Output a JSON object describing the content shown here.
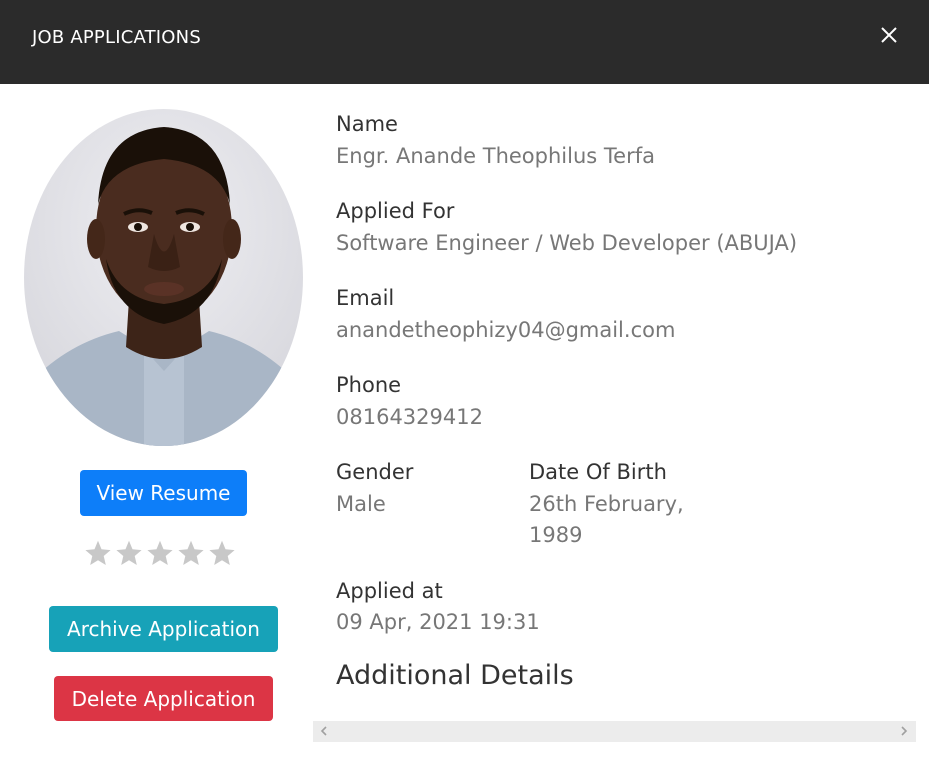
{
  "header": {
    "title": "JOB APPLICATIONS",
    "close_icon": "close-icon"
  },
  "applicant": {
    "name_label": "Name",
    "name": "Engr. Anande Theophilus Terfa",
    "applied_for_label": "Applied For",
    "applied_for": "Software Engineer / Web Developer (ABUJA)",
    "email_label": "Email",
    "email": "anandetheophizy04@gmail.com",
    "phone_label": "Phone",
    "phone": "08164329412",
    "gender_label": "Gender",
    "gender": "Male",
    "dob_label": "Date Of Birth",
    "dob_line1": "26th February,",
    "dob_line2": "1989",
    "applied_at_label": "Applied at",
    "applied_at": "09 Apr, 2021 19:31"
  },
  "actions": {
    "view_resume": "View Resume",
    "archive": "Archive Application",
    "delete": "Delete Application"
  },
  "rating": {
    "value": 0,
    "max": 5,
    "icon": "star-icon"
  },
  "additional": {
    "title": "Additional Details"
  },
  "colors": {
    "header_bg": "#2b2b2b",
    "primary": "#0d7ef9",
    "info": "#17a2b8",
    "danger": "#dc3545",
    "star_inactive": "#c8c8c8"
  }
}
